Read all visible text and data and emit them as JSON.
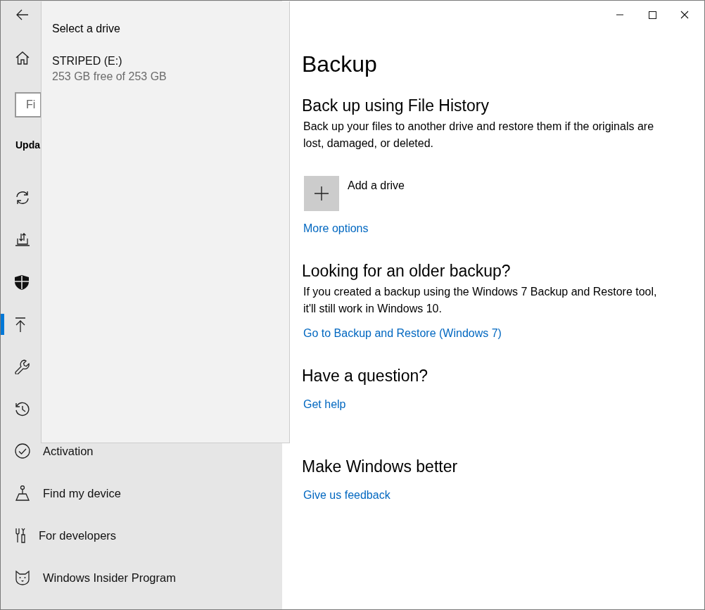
{
  "sidebar": {
    "search": {
      "placeholder": "Fi"
    },
    "heading": "Upda",
    "items": [
      {
        "selected": false
      },
      {
        "selected": false
      },
      {
        "selected": false
      },
      {
        "selected": true
      },
      {
        "selected": false
      },
      {
        "selected": false
      },
      {
        "label": "Activation",
        "selected": false
      },
      {
        "label": "Find my device",
        "selected": false
      },
      {
        "label": "For developers",
        "selected": false
      },
      {
        "label": "Windows Insider Program",
        "selected": false
      }
    ]
  },
  "flyout": {
    "title": "Select a drive",
    "drives": [
      {
        "name": "STRIPED (E:)",
        "detail": "253 GB free of 253 GB"
      }
    ]
  },
  "main": {
    "title": "Backup",
    "sections": [
      {
        "heading": "Back up using File History",
        "text": "Back up your files to another drive and restore them if the originals are lost, damaged, or deleted.",
        "add_label": "Add a drive",
        "link": "More options"
      },
      {
        "heading": "Looking for an older backup?",
        "text": "If you created a backup using the Windows 7 Backup and Restore tool, it'll still work in Windows 10.",
        "link": "Go to Backup and Restore (Windows 7)"
      },
      {
        "heading": "Have a question?",
        "link": "Get help"
      },
      {
        "heading": "Make Windows better",
        "link": "Give us feedback"
      }
    ]
  }
}
